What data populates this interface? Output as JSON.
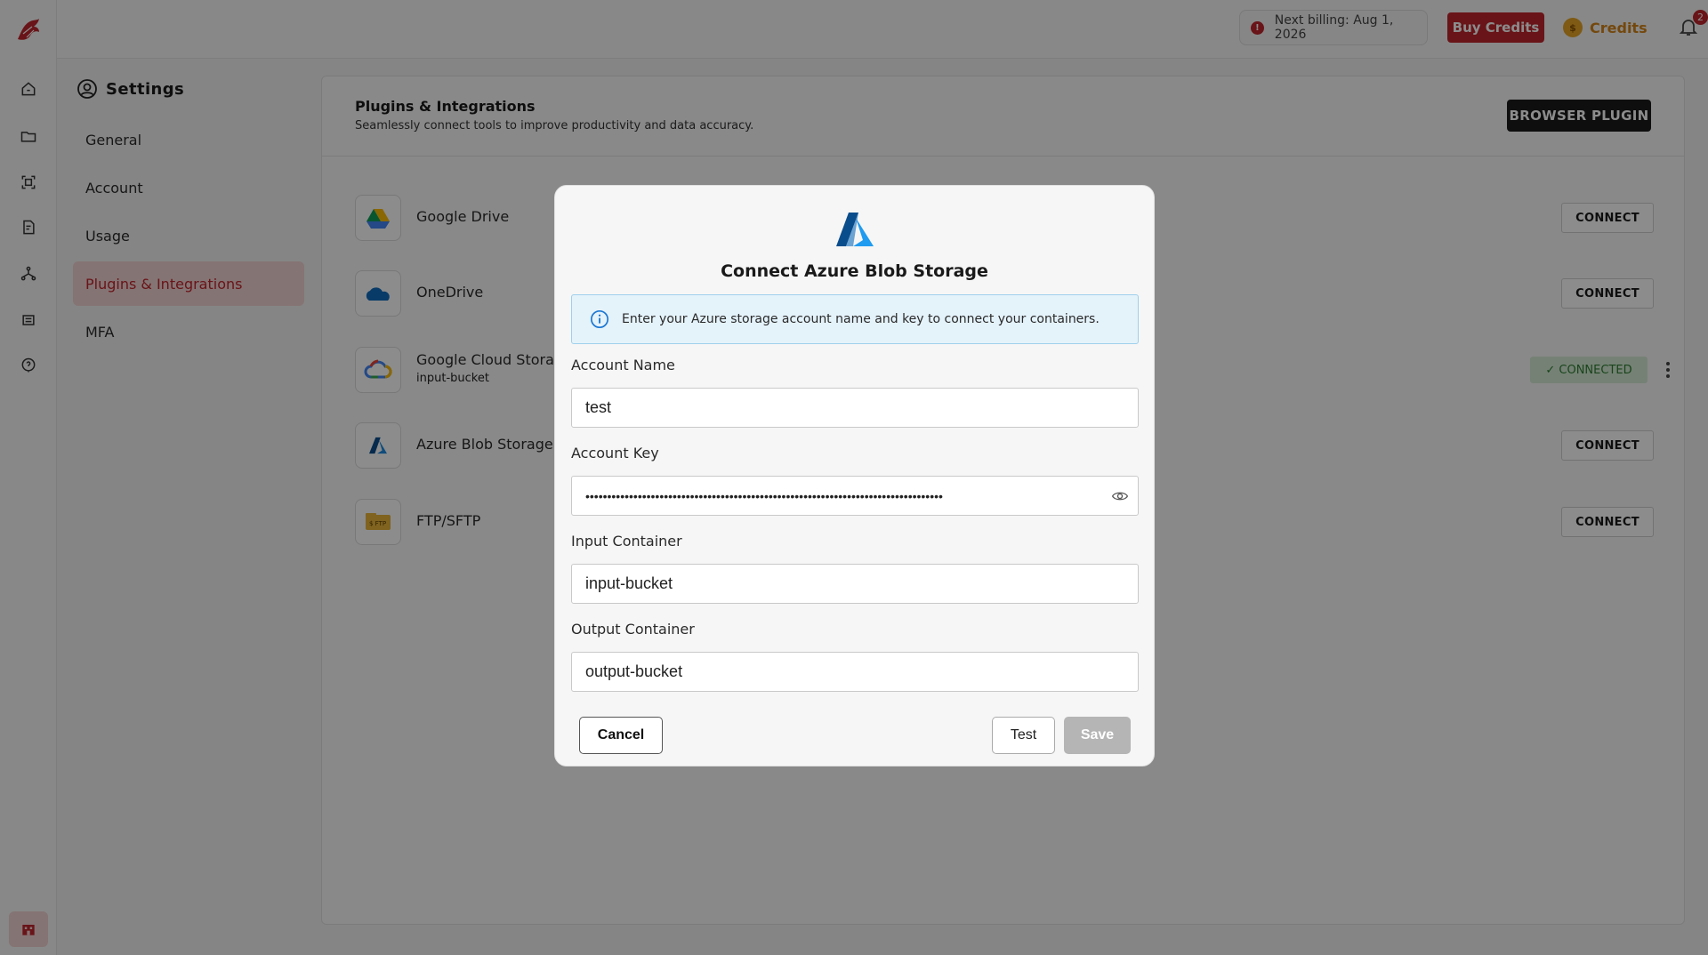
{
  "topbar": {
    "billing_text": "Next billing: Aug 1, 2026",
    "buy_credits_label": "Buy Credits",
    "credits_label": "Credits",
    "notification_count": "2"
  },
  "settings": {
    "title": "Settings",
    "nav": [
      {
        "label": "General"
      },
      {
        "label": "Account"
      },
      {
        "label": "Usage"
      },
      {
        "label": "Plugins & Integrations"
      },
      {
        "label": "MFA"
      }
    ]
  },
  "panel": {
    "title": "Plugins & Integrations",
    "subtitle": "Seamlessly connect tools to improve productivity and data accuracy.",
    "browser_plugin_label": "BROWSER PLUGIN",
    "integrations": [
      {
        "name": "Google Drive",
        "action": "CONNECT"
      },
      {
        "name": "OneDrive",
        "action": "CONNECT"
      },
      {
        "name": "Google Cloud Storag",
        "sub": "input-bucket",
        "status": "✓ CONNECTED"
      },
      {
        "name": "Azure Blob Storage",
        "action": "CONNECT"
      },
      {
        "name": "FTP/SFTP",
        "action": "CONNECT"
      }
    ]
  },
  "modal": {
    "title": "Connect Azure Blob Storage",
    "info": "Enter your Azure storage account name and key to connect your containers.",
    "account_name_label": "Account Name",
    "account_name_value": "test",
    "account_key_label": "Account Key",
    "account_key_value": "••••••••••••••••••••••••••••••••••••••••••••••••••••••••••••••••••••••••••••••••••",
    "input_container_label": "Input Container",
    "input_container_value": "input-bucket",
    "output_container_label": "Output Container",
    "output_container_value": "output-bucket",
    "cancel_label": "Cancel",
    "test_label": "Test",
    "save_label": "Save"
  },
  "colors": {
    "brand_red": "#c0262d",
    "credits_gold": "#d38418",
    "connected_green": "#2e7d32"
  }
}
